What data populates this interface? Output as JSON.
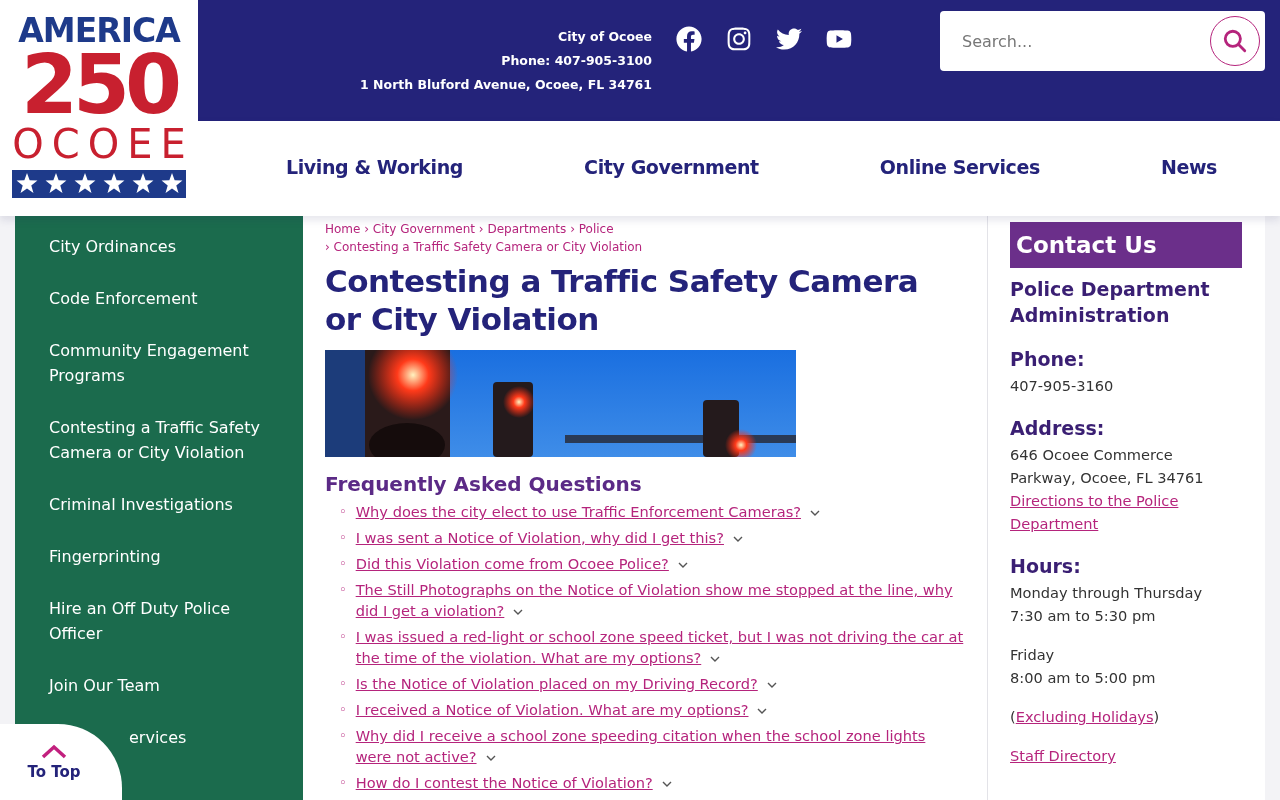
{
  "logo": {
    "line_1": "AMERICA",
    "line_2": "250",
    "line_3": "OCOEE"
  },
  "header": {
    "contact_lines": [
      "City of Ocoee",
      "Phone: 407-905-3100",
      "1 North Bluford Avenue, Ocoee, FL 34761"
    ],
    "social": [
      {
        "kind": "facebook"
      },
      {
        "kind": "instagram"
      },
      {
        "kind": "twitter"
      },
      {
        "kind": "youtube"
      }
    ],
    "search": {
      "placeholder": "Search..."
    }
  },
  "nav": [
    "Living & Working",
    "City Government",
    "Online Services",
    "News"
  ],
  "sidebar": {
    "items": [
      "City Ordinances",
      "Code Enforcement",
      "Community Engagement Programs",
      "Contesting a Traffic Safety Camera or City Violation",
      "Criminal Investigations",
      "Fingerprinting",
      "Hire an Off Duty Police Officer",
      "Join Our Team"
    ],
    "covered_item": "ervices"
  },
  "breadcrumb": [
    "Home › City Government › Departments › Police",
    "› Contesting a Traffic Safety Camera or City Violation"
  ],
  "title": "Contesting a Traffic Safety Camera or City Violation",
  "hero": {
    "kind": "picture"
  },
  "faq": {
    "heading": "Frequently Asked Questions",
    "bullet": "◦",
    "items": [
      "Why does the city elect to use Traffic Enforcement Cameras?",
      "I was sent a Notice of Violation, why did I get this?",
      "Did this Violation come from Ocoee Police?",
      "The Still Photographs on the Notice of Violation show me stopped at the line, why did I get a violation?",
      "I was issued a red-light or school zone speed ticket, but I was not driving the car at the time of the violation. What are my options?",
      "Is the Notice of Violation placed on my Driving Record?",
      "I received a Notice of Violation. What are my options?",
      "Why did I receive a school zone speeding citation when the school zone lights were not active?",
      "How do I contest the Notice of Violation?"
    ]
  },
  "contact": {
    "heading": "Contact Us",
    "department": "Police Department Administration",
    "phone_label": "Phone:",
    "phone": "407-905-3160",
    "address_label": "Address:",
    "address": "646 Ocoee Commerce Parkway, Ocoee, FL 34761",
    "directions_link": "Directions to the Police Department",
    "hours_label": "Hours:",
    "hours": [
      [
        "Monday through Thursday",
        "7:30 am to 5:30 pm"
      ],
      [
        "Friday",
        "8:00 am to 5:00 pm"
      ]
    ],
    "holidays_open": "(",
    "holidays_link": "Excluding Holidays",
    "holidays_close": ")",
    "staff_link": "Staff Directory"
  },
  "to_top": "To Top"
}
